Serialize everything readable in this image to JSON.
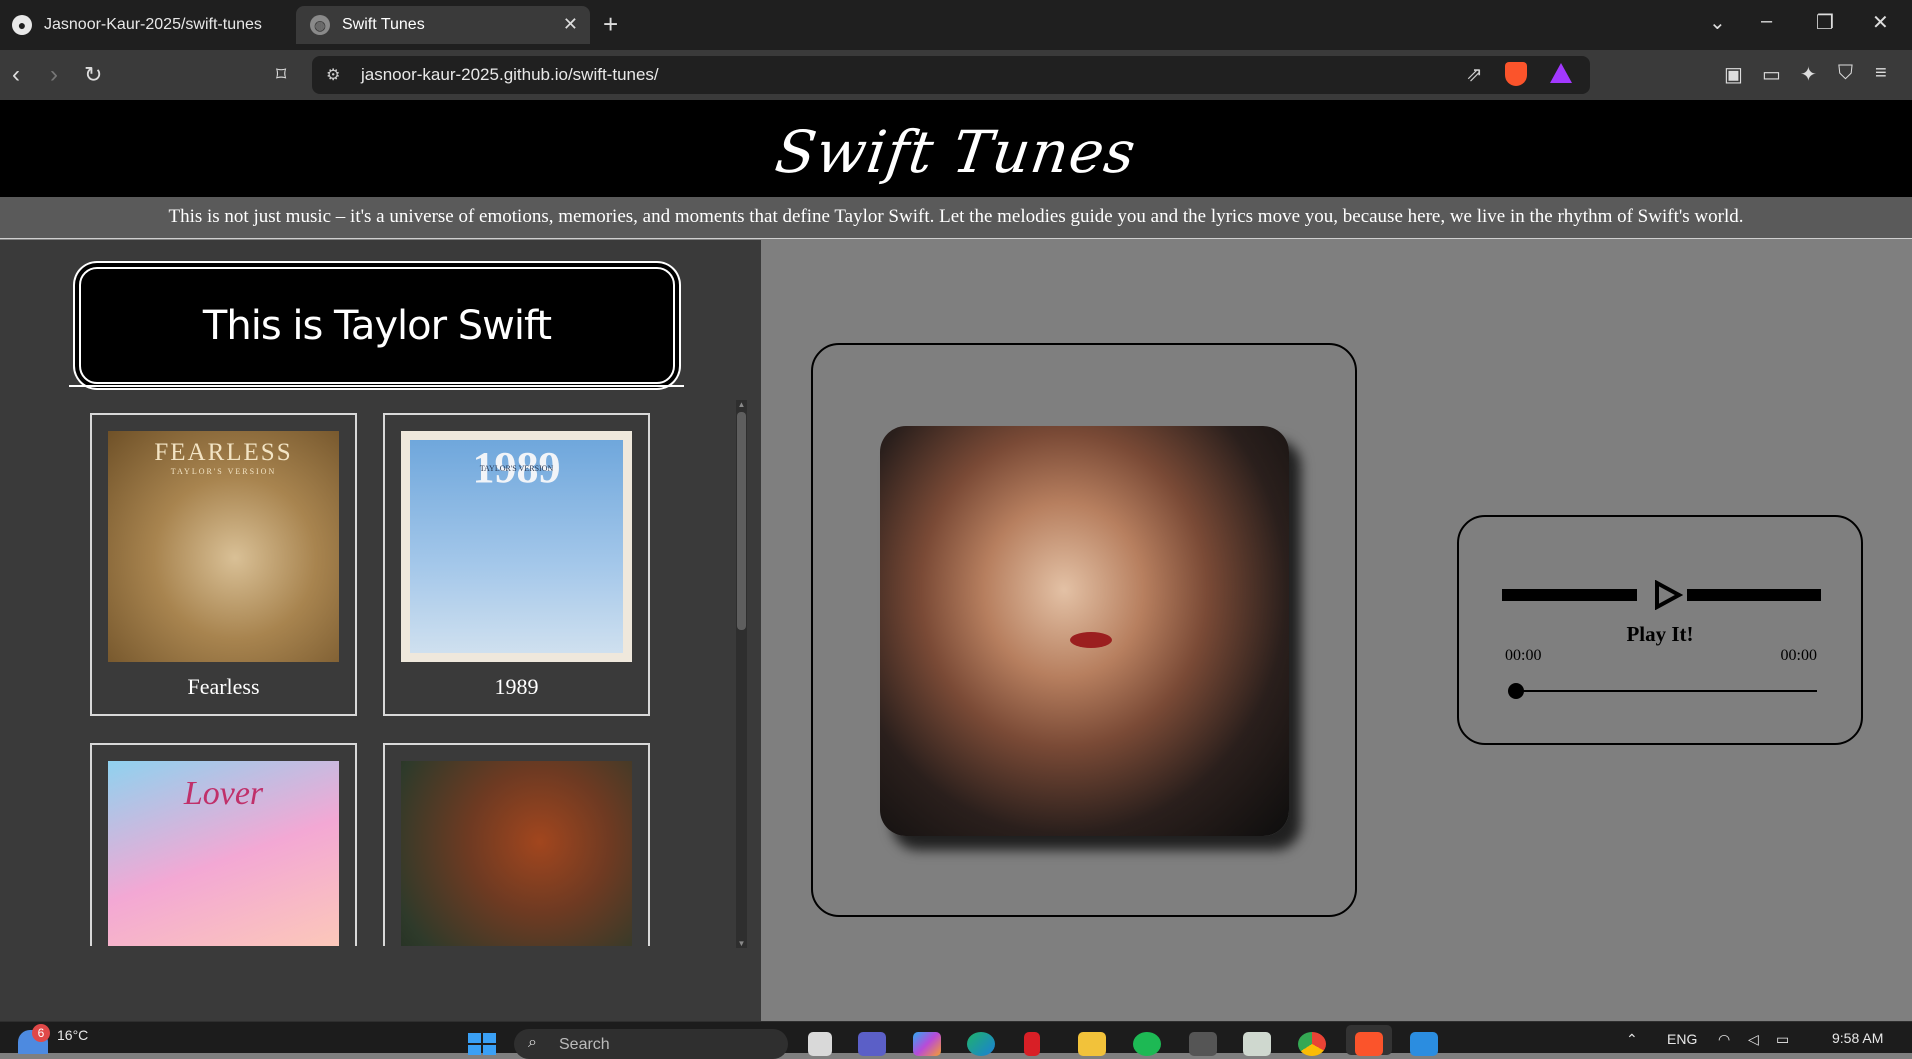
{
  "browser": {
    "tabs": [
      {
        "label": "Jasnoor-Kaur-2025/swift-tunes",
        "icon": "github-icon",
        "active": false
      },
      {
        "label": "Swift Tunes",
        "icon": "globe-icon",
        "active": true
      }
    ],
    "url": "jasnoor-kaur-2025.github.io/swift-tunes/"
  },
  "page": {
    "site_title": "Swift Tunes",
    "tagline": "This is not just music – it's a universe of emotions, memories, and moments that define Taylor Swift. Let the melodies guide you and the lyrics move you, because here, we live in the rhythm of Swift's world.",
    "playlist_title": "This is Taylor Swift",
    "albums": [
      {
        "name": "Fearless",
        "cover_text": "FEARLESS",
        "cover_subtext": "TAYLOR'S VERSION"
      },
      {
        "name": "1989",
        "cover_text": "1989",
        "cover_subtext": "TAYLOR'S VERSION"
      },
      {
        "name": "",
        "cover_text": "Lover",
        "cover_subtext": ""
      },
      {
        "name": "",
        "cover_text": "",
        "cover_subtext": ""
      }
    ]
  },
  "player": {
    "label": "Play It!",
    "current_time": "00:00",
    "total_time": "00:00",
    "progress": 0
  },
  "taskbar": {
    "weather_badge": "6",
    "temperature": "16°C",
    "search_placeholder": "Search",
    "language": "ENG",
    "time": "9:58 AM"
  },
  "colors": {
    "page_bg": "#7f7f7f",
    "header_bg": "#000000",
    "left_panel_bg": "#3a3a3a",
    "brave_orange": "#fb542b"
  }
}
